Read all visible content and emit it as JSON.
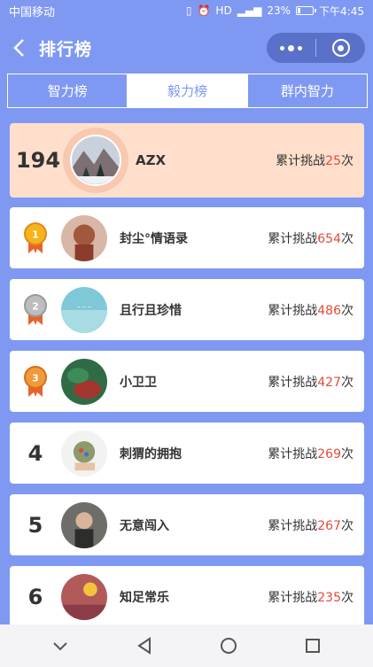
{
  "status": {
    "carrier": "中国移动",
    "battery_text": "23%",
    "battery_level": 0.23,
    "time": "下午4:45"
  },
  "nav": {
    "title": "排行榜"
  },
  "tabs": [
    {
      "label": "智力榜",
      "active": false
    },
    {
      "label": "毅力榜",
      "active": true
    },
    {
      "label": "群内智力",
      "active": false
    }
  ],
  "me": {
    "rank": "194",
    "name": "AZX",
    "count_prefix": "累计挑战",
    "count": "25",
    "count_suffix": "次"
  },
  "rows": [
    {
      "rank": "1",
      "medal": "gold",
      "name": "封尘°情语录",
      "count_prefix": "累计挑战",
      "count": "654",
      "count_suffix": "次"
    },
    {
      "rank": "2",
      "medal": "silver",
      "name": "且行且珍惜",
      "count_prefix": "累计挑战",
      "count": "486",
      "count_suffix": "次"
    },
    {
      "rank": "3",
      "medal": "bronze",
      "name": "小卫卫",
      "count_prefix": "累计挑战",
      "count": "427",
      "count_suffix": "次"
    },
    {
      "rank": "4",
      "medal": "",
      "name": "刺猬的拥抱",
      "count_prefix": "累计挑战",
      "count": "269",
      "count_suffix": "次"
    },
    {
      "rank": "5",
      "medal": "",
      "name": "无意闯入",
      "count_prefix": "累计挑战",
      "count": "267",
      "count_suffix": "次"
    },
    {
      "rank": "6",
      "medal": "",
      "name": "知足常乐",
      "count_prefix": "累计挑战",
      "count": "235",
      "count_suffix": "次"
    }
  ],
  "colors": {
    "background": "#7f99f2",
    "highlight_card": "#ffdfcc",
    "count_accent": "#e14c3a"
  },
  "icons": {
    "back": "chevron-left-icon",
    "more": "more-dots-icon",
    "close": "target-circle-icon",
    "sys_back": "triangle-back-icon",
    "sys_home": "circle-home-icon",
    "sys_recent": "square-recent-icon",
    "sys_collapse": "chevron-down-icon"
  }
}
